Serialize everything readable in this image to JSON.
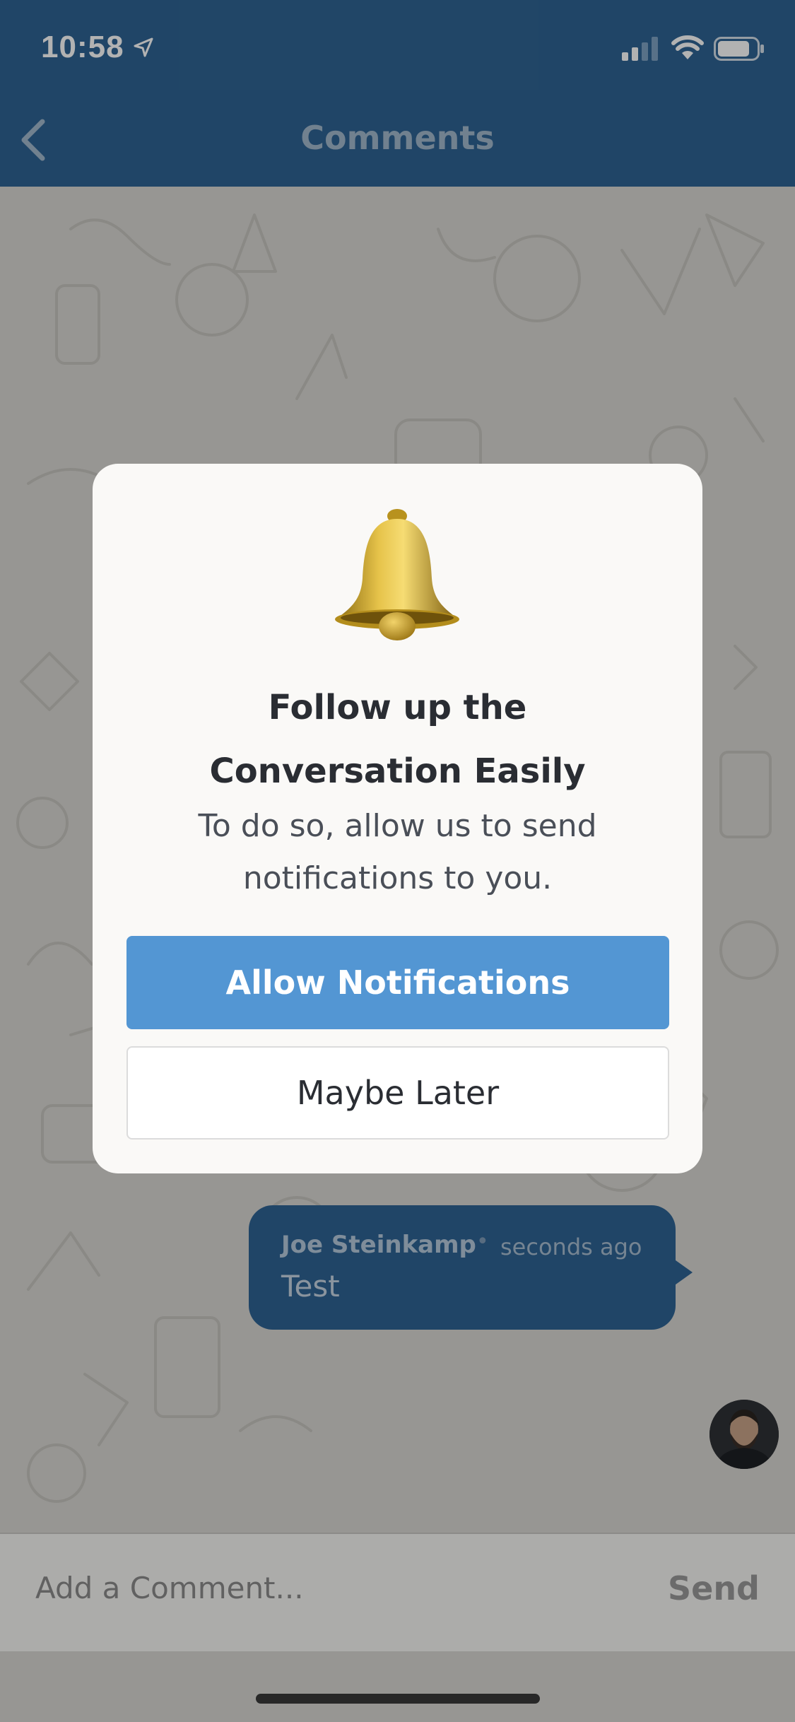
{
  "status_bar": {
    "time": "10:58",
    "location_icon": "location-arrow-icon",
    "signal_icon": "cellular-signal-icon",
    "wifi_icon": "wifi-icon",
    "battery_icon": "battery-icon"
  },
  "nav": {
    "title": "Comments",
    "back_icon": "chevron-left-icon"
  },
  "comment": {
    "author": "Joe Steinkamp",
    "separator": "•",
    "time": "seconds ago",
    "text": "Test"
  },
  "input_bar": {
    "placeholder": "Add a Comment...",
    "send_label": "Send"
  },
  "modal": {
    "icon": "bell-icon",
    "title_line1": "Follow up the",
    "title_line2": "Conversation Easily",
    "subtitle_line1": "To do so, allow us to send",
    "subtitle_line2": "notifications to you.",
    "primary_label": "Allow Notifications",
    "secondary_label": "Maybe Later"
  },
  "colors": {
    "header": "#2f6494",
    "primary_button": "#5396d3",
    "modal_bg": "#faf9f7"
  }
}
